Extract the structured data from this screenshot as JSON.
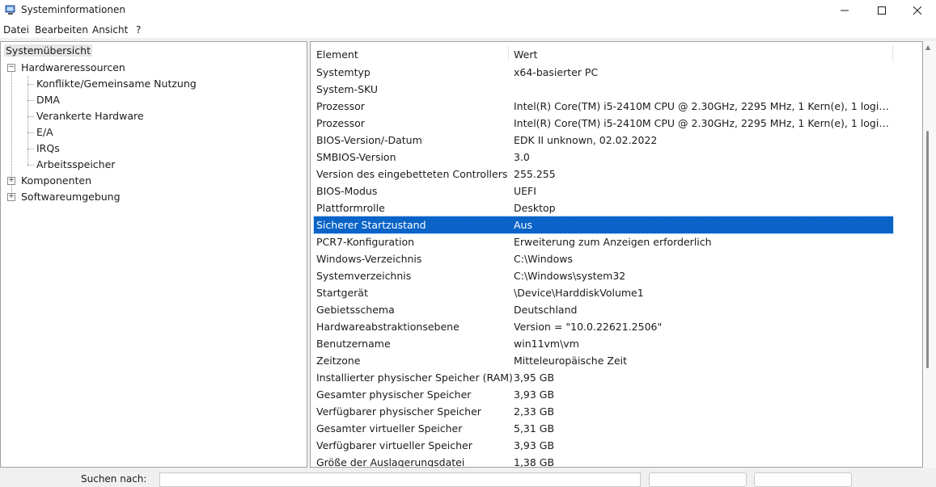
{
  "window": {
    "title": "Systeminformationen"
  },
  "menu": [
    "Datei",
    "Bearbeiten",
    "Ansicht",
    "?"
  ],
  "tree": {
    "root": "Systemübersicht",
    "nodes": [
      {
        "label": "Hardwareressourcen",
        "expanded": true,
        "children": [
          "Konflikte/Gemeinsame Nutzung",
          "DMA",
          "Verankerte Hardware",
          "E/A",
          "IRQs",
          "Arbeitsspeicher"
        ]
      },
      {
        "label": "Komponenten",
        "expanded": false
      },
      {
        "label": "Softwareumgebung",
        "expanded": false
      }
    ]
  },
  "table": {
    "columns": [
      "Element",
      "Wert"
    ],
    "selected_index": 9,
    "rows": [
      [
        "Systemtyp",
        "x64-basierter PC"
      ],
      [
        "System-SKU",
        ""
      ],
      [
        "Prozessor",
        "Intel(R) Core(TM) i5-2410M CPU @ 2.30GHz, 2295 MHz, 1 Kern(e), 1 logische(..."
      ],
      [
        "Prozessor",
        "Intel(R) Core(TM) i5-2410M CPU @ 2.30GHz, 2295 MHz, 1 Kern(e), 1 logische(..."
      ],
      [
        "BIOS-Version/-Datum",
        "EDK II unknown, 02.02.2022"
      ],
      [
        "SMBIOS-Version",
        "3.0"
      ],
      [
        "Version des eingebetteten Controllers",
        "255.255"
      ],
      [
        "BIOS-Modus",
        "UEFI"
      ],
      [
        "Plattformrolle",
        "Desktop"
      ],
      [
        "Sicherer Startzustand",
        "Aus"
      ],
      [
        "PCR7-Konfiguration",
        "Erweiterung zum Anzeigen erforderlich"
      ],
      [
        "Windows-Verzeichnis",
        "C:\\Windows"
      ],
      [
        "Systemverzeichnis",
        "C:\\Windows\\system32"
      ],
      [
        "Startgerät",
        "\\Device\\HarddiskVolume1"
      ],
      [
        "Gebietsschema",
        "Deutschland"
      ],
      [
        "Hardwareabstraktionsebene",
        "Version = \"10.0.22621.2506\""
      ],
      [
        "Benutzername",
        "win11vm\\vm"
      ],
      [
        "Zeitzone",
        "Mitteleuropäische Zeit"
      ],
      [
        "Installierter physischer Speicher (RAM)",
        "3,95 GB"
      ],
      [
        "Gesamter physischer Speicher",
        "3,93 GB"
      ],
      [
        "Verfügbarer physischer Speicher",
        "2,33 GB"
      ],
      [
        "Gesamter virtueller Speicher",
        "5,31 GB"
      ],
      [
        "Verfügbarer virtueller Speicher",
        "3,93 GB"
      ],
      [
        "Größe der Auslagerungsdatei",
        "1,38 GB"
      ]
    ]
  },
  "search": {
    "label": "Suchen nach:",
    "value": ""
  },
  "colors": {
    "selection": "#0a64c8",
    "tree_selected": "#e5e5e5"
  }
}
